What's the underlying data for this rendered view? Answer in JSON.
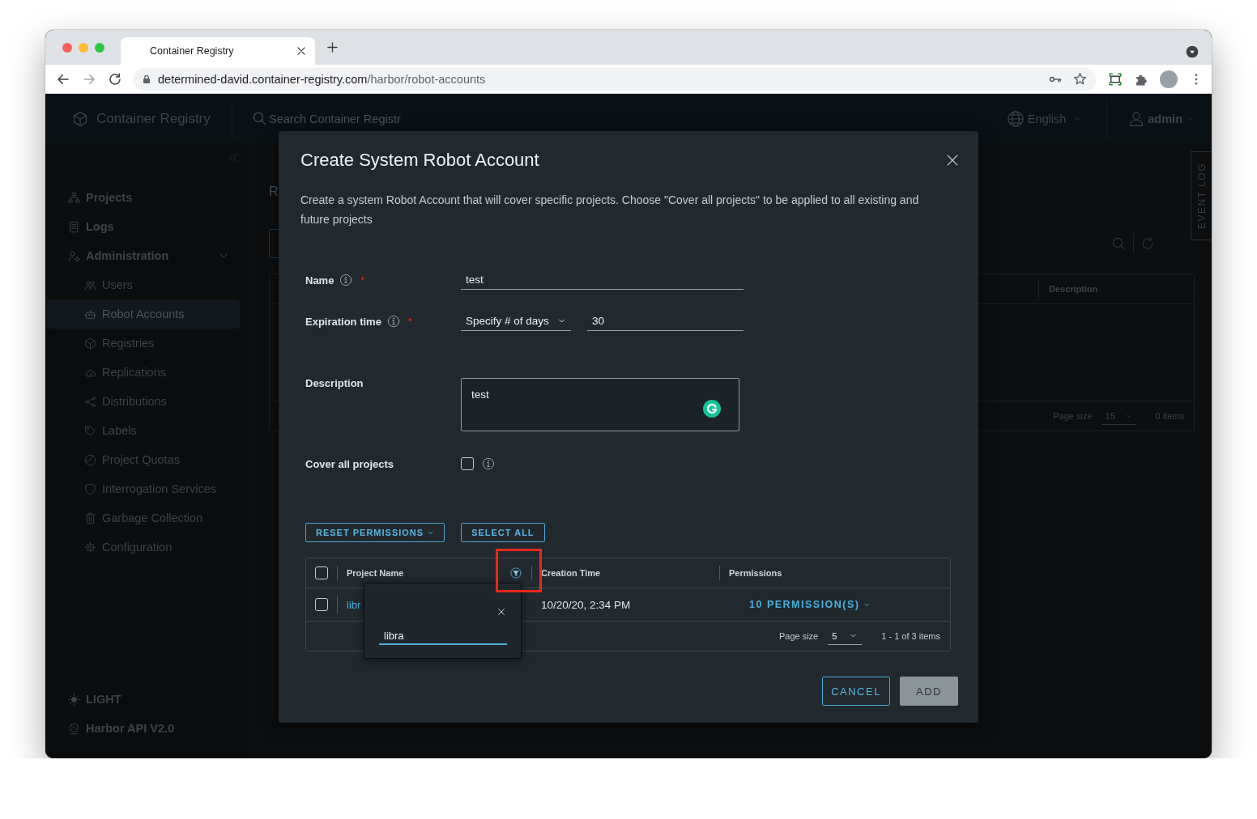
{
  "browser": {
    "tab_title": "Container Registry",
    "url_host": "determined-david.container-registry.com",
    "url_path": "/harbor/robot-accounts"
  },
  "header": {
    "app_name": "Container Registry",
    "search_placeholder": "Search Container Registr",
    "language": "English",
    "user": "admin"
  },
  "sidebar": {
    "items": [
      {
        "label": "Projects",
        "selected": false
      },
      {
        "label": "Logs",
        "selected": false
      },
      {
        "label": "Administration",
        "selected": false,
        "expanded": true,
        "children": [
          {
            "label": "Users",
            "selected": false
          },
          {
            "label": "Robot Accounts",
            "selected": true
          },
          {
            "label": "Registries",
            "selected": false
          },
          {
            "label": "Replications",
            "selected": false
          },
          {
            "label": "Distributions",
            "selected": false
          },
          {
            "label": "Labels",
            "selected": false
          },
          {
            "label": "Project Quotas",
            "selected": false
          },
          {
            "label": "Interrogation Services",
            "selected": false
          },
          {
            "label": "Garbage Collection",
            "selected": false
          },
          {
            "label": "Configuration",
            "selected": false
          }
        ]
      }
    ],
    "footer": [
      {
        "label": "LIGHT"
      },
      {
        "label": "Harbor API V2.0"
      }
    ]
  },
  "page": {
    "title": "R",
    "table": {
      "columns": [
        "Description"
      ],
      "page_size_label": "Page size",
      "page_size": "15",
      "count": "0 items"
    }
  },
  "event_log": "EVENT LOG",
  "modal": {
    "title": "Create System Robot Account",
    "description": "Create a system Robot Account that will cover specific projects. Choose \"Cover all projects\" to be applied to all existing and future projects",
    "fields": [
      {
        "kind": "text",
        "label": "Name",
        "info": true,
        "required_mark": "*",
        "value": "test"
      },
      {
        "kind": "expiration",
        "label": "Expiration time",
        "info": true,
        "required_mark": "*",
        "select": "Specify # of days",
        "value": "30"
      },
      {
        "kind": "textarea",
        "label": "Description",
        "info": false,
        "value": "test"
      },
      {
        "kind": "checkbox",
        "label": "Cover all projects",
        "info": true,
        "checked": false
      }
    ],
    "actions": [
      {
        "label": "RESET PERMISSIONS",
        "dropdown": true
      },
      {
        "label": "SELECT ALL",
        "dropdown": false
      }
    ],
    "table": {
      "all_checked": false,
      "columns": [
        {
          "label": "Project Name",
          "filter": true
        },
        {
          "label": "Creation Time",
          "filter": false
        },
        {
          "label": "Permissions",
          "filter": false
        }
      ],
      "rows": [
        {
          "checked": false,
          "project": "libr",
          "created": "10/20/20, 2:34 PM",
          "permissions": "10 PERMISSION(S)"
        }
      ],
      "page_size_label": "Page size",
      "page_size": "5",
      "range": "1 - 1 of 3 items"
    },
    "filter_popup": {
      "value": "libra"
    },
    "buttons": [
      {
        "label": "CANCEL",
        "kind": "outline",
        "disabled": false
      },
      {
        "label": "ADD",
        "kind": "solid",
        "disabled": true
      }
    ]
  }
}
